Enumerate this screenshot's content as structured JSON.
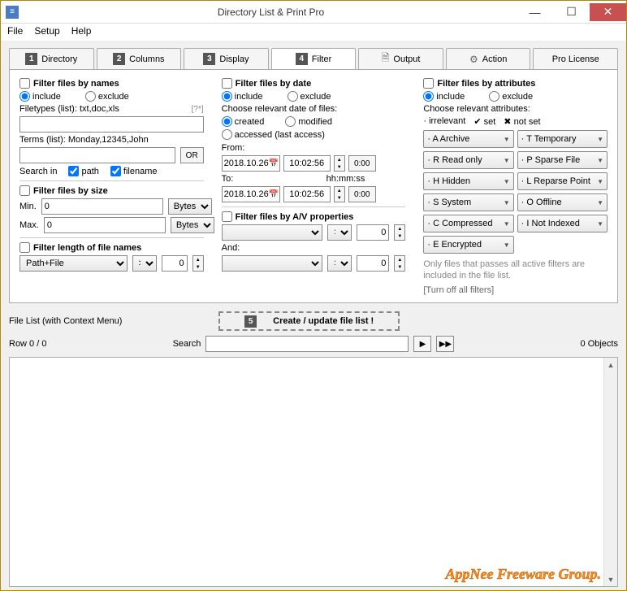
{
  "window": {
    "title": "Directory List & Print Pro"
  },
  "menu": {
    "file": "File",
    "setup": "Setup",
    "help": "Help"
  },
  "tabs": [
    {
      "n": "1",
      "label": "Directory"
    },
    {
      "n": "2",
      "label": "Columns"
    },
    {
      "n": "3",
      "label": "Display"
    },
    {
      "n": "4",
      "label": "Filter"
    },
    {
      "n": "",
      "label": "Output",
      "icon": "doc"
    },
    {
      "n": "",
      "label": "Action",
      "icon": "gear"
    },
    {
      "n": "",
      "label": "Pro License"
    }
  ],
  "col1": {
    "names_title": "Filter files by names",
    "include": "include",
    "exclude": "exclude",
    "filetypes_label": "Filetypes (list): txt,doc,xls",
    "filetypes_hint": "[?*]",
    "terms_label": "Terms (list): Monday,12345,John",
    "or": "OR",
    "searchin": "Search in",
    "path": "path",
    "filename": "filename",
    "size_title": "Filter files by size",
    "min": "Min.",
    "max": "Max.",
    "min_v": "0",
    "max_v": "0",
    "unit": "Bytes",
    "len_title": "Filter length of file names",
    "pathfile": "Path+File",
    "op": "> =",
    "len_v": "0"
  },
  "col2": {
    "date_title": "Filter files by date",
    "include": "include",
    "exclude": "exclude",
    "choose": "Choose relevant date of files:",
    "created": "created",
    "modified": "modified",
    "accessed": "accessed (last access)",
    "from": "From:",
    "to": "To:",
    "hhmmss": "hh:mm:ss",
    "d1": "2018.10.26",
    "t1": "10:02:56",
    "z": "0:00",
    "d2": "2018.10.26",
    "t2": "10:02:56",
    "av_title": "Filter files by A/V properties",
    "and": "And:",
    "op": "> =",
    "v": "0"
  },
  "col3": {
    "attr_title": "Filter files by attributes",
    "include": "include",
    "exclude": "exclude",
    "choose": "Choose relevant attributes:",
    "leg_irr": "irrelevant",
    "leg_set": "set",
    "leg_not": "not set",
    "attrs_left": [
      "A  Archive",
      "R  Read only",
      "H  Hidden",
      "S  System",
      "C  Compressed",
      "E  Encrypted"
    ],
    "attrs_right": [
      "T  Temporary",
      "P  Sparse File",
      "L  Reparse Point",
      "O  Offline",
      "I  Not Indexed"
    ],
    "note": "Only files that passes all active filters are included in the file list.",
    "turnoff": "[Turn off all filters]"
  },
  "bottom": {
    "filelist": "File List (with Context Menu)",
    "create_n": "5",
    "create": "Create / update file list !",
    "row": "Row 0 / 0",
    "search": "Search",
    "objects": "0 Objects"
  },
  "watermark": "AppNee Freeware Group."
}
